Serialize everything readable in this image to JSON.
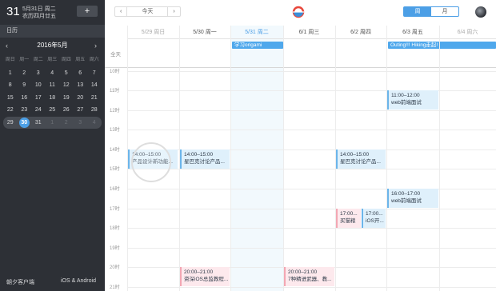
{
  "sidebar": {
    "day": "31",
    "date_line": "5月31日 周二",
    "lunar_line": "农历四月廿五",
    "add_label": "+",
    "section_label": "日历",
    "month_label": "2016年5月",
    "prev_icon": "‹",
    "next_icon": "›",
    "weekdays": [
      "周日",
      "周一",
      "周二",
      "周三",
      "周四",
      "周五",
      "周六"
    ],
    "weeks": [
      [
        "1",
        "2",
        "3",
        "4",
        "5",
        "6",
        "7"
      ],
      [
        "8",
        "9",
        "10",
        "11",
        "12",
        "13",
        "14"
      ],
      [
        "15",
        "16",
        "17",
        "18",
        "19",
        "20",
        "21"
      ],
      [
        "22",
        "23",
        "24",
        "25",
        "26",
        "27",
        "28"
      ],
      [
        "29",
        "30",
        "31",
        "1",
        "2",
        "3",
        "4"
      ]
    ],
    "footer_left": "朝夕客户端",
    "footer_right": "iOS & Android"
  },
  "toolbar": {
    "prev_label": "‹",
    "today_label": "今天",
    "next_label": "›",
    "logo_icon": "app-logo-icon",
    "view_week": "周",
    "view_month": "月",
    "active_view": "周"
  },
  "calendar": {
    "days": [
      {
        "label": "5/29 周日",
        "type": "weekend"
      },
      {
        "label": "5/30 周一",
        "type": "normal"
      },
      {
        "label": "5/31 周二",
        "type": "today"
      },
      {
        "label": "6/1 周三",
        "type": "normal"
      },
      {
        "label": "6/2 周四",
        "type": "normal"
      },
      {
        "label": "6/3 周五",
        "type": "normal"
      },
      {
        "label": "6/4 周六",
        "type": "weekend"
      }
    ],
    "allday_label": "全天",
    "hours": [
      "10时",
      "11时",
      "12时",
      "13时",
      "14时",
      "15时",
      "16时",
      "17时",
      "18时",
      "19时",
      "20时",
      "21时"
    ],
    "allday_events": [
      {
        "title": "学习origami"
      },
      {
        "title": "Outing!!! Hiking走起!"
      }
    ],
    "events": {
      "sun_design": {
        "time": "14:00–15:00",
        "title": "产品设计新功能..."
      },
      "mon_starbucks": {
        "time": "14:00–15:00",
        "title": "星巴克讨论产品..."
      },
      "mon_evening": {
        "time": "20:00–21:00",
        "title": "资深iOS总监教程..."
      },
      "wed_evening": {
        "time": "20:00–21:00",
        "title": "7种精进武器、教..."
      },
      "thu_starbucks": {
        "time": "14:00–15:00",
        "title": "星巴克讨论产品..."
      },
      "thu_cat": {
        "time": "17:00...",
        "title": "买猫粮"
      },
      "thu_ios": {
        "time": "17:00...",
        "title": "iOS开..."
      },
      "fri_interview1": {
        "time": "11:00–12:00",
        "title": "web前端面试"
      },
      "fri_interview2": {
        "time": "16:00–17:00",
        "title": "web前端面试"
      }
    }
  },
  "colors": {
    "accent": "#4c9fe6",
    "sidebar_bg": "#2d3036",
    "event_blue": "#dff0fb",
    "event_pink": "#fde9ed"
  }
}
